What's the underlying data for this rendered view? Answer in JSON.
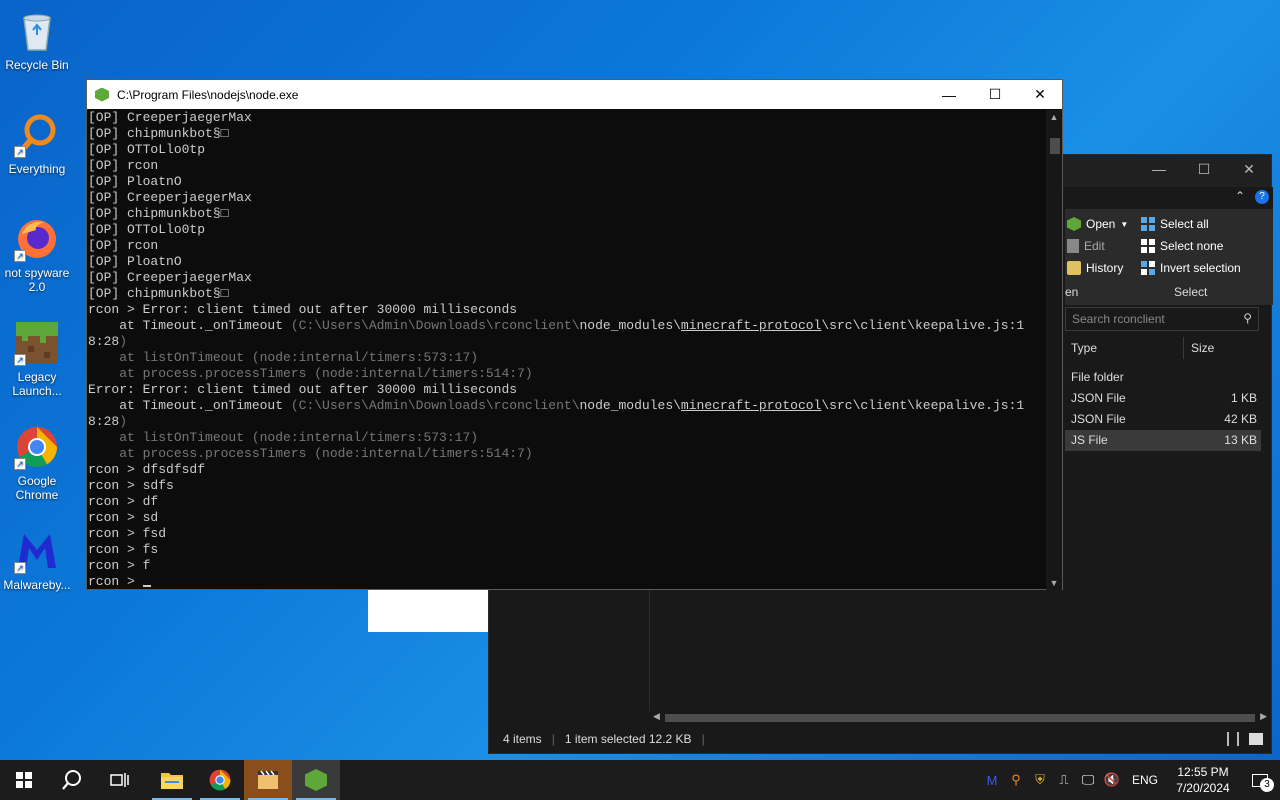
{
  "desktop": {
    "icons": [
      {
        "label": "Recycle Bin"
      },
      {
        "label": "Everything"
      },
      {
        "label": "not spyware 2.0"
      },
      {
        "label": "Legacy Launch..."
      },
      {
        "label": "Google Chrome"
      },
      {
        "label": "Malwareby..."
      }
    ]
  },
  "console": {
    "title": "C:\\Program Files\\nodejs\\node.exe",
    "lines": [
      {
        "segments": [
          {
            "t": "[OP] CreeperjaegerMax"
          }
        ]
      },
      {
        "segments": [
          {
            "t": "[OP] chipmunkbot§□"
          }
        ]
      },
      {
        "segments": [
          {
            "t": "[OP] OTToLlo0tp"
          }
        ]
      },
      {
        "segments": [
          {
            "t": "[OP] rcon"
          }
        ]
      },
      {
        "segments": [
          {
            "t": "[OP] PloatnO"
          }
        ]
      },
      {
        "segments": [
          {
            "t": "[OP] CreeperjaegerMax"
          }
        ]
      },
      {
        "segments": [
          {
            "t": "[OP] chipmunkbot§□"
          }
        ]
      },
      {
        "segments": [
          {
            "t": "[OP] OTToLlo0tp"
          }
        ]
      },
      {
        "segments": [
          {
            "t": "[OP] rcon"
          }
        ]
      },
      {
        "segments": [
          {
            "t": "[OP] PloatnO"
          }
        ]
      },
      {
        "segments": [
          {
            "t": "[OP] CreeperjaegerMax"
          }
        ]
      },
      {
        "segments": [
          {
            "t": "[OP] chipmunkbot§□"
          }
        ]
      },
      {
        "segments": [
          {
            "t": "rcon > Error: client timed out after 30000 milliseconds"
          }
        ]
      },
      {
        "segments": [
          {
            "t": "    at Timeout._onTimeout "
          },
          {
            "t": "(C:\\Users\\Admin\\Downloads\\rconclient\\",
            "c": "dim"
          },
          {
            "t": "node_modules\\"
          },
          {
            "t": "minecraft-protocol",
            "c": "ul"
          },
          {
            "t": "\\src\\client\\keepalive.js:1"
          }
        ]
      },
      {
        "segments": [
          {
            "t": "8:28",
            "c": ""
          },
          {
            "t": ")",
            "c": "dim"
          }
        ]
      },
      {
        "segments": [
          {
            "t": "    at listOnTimeout (node:internal/timers:573:17)",
            "c": "dim"
          }
        ]
      },
      {
        "segments": [
          {
            "t": "    at process.processTimers (node:internal/timers:514:7)",
            "c": "dim"
          }
        ]
      },
      {
        "segments": [
          {
            "t": "Error: Error: client timed out after 30000 milliseconds"
          }
        ]
      },
      {
        "segments": [
          {
            "t": "    at Timeout._onTimeout "
          },
          {
            "t": "(C:\\Users\\Admin\\Downloads\\rconclient\\",
            "c": "dim"
          },
          {
            "t": "node_modules\\"
          },
          {
            "t": "minecraft-protocol",
            "c": "ul"
          },
          {
            "t": "\\src\\client\\keepalive.js:1"
          }
        ]
      },
      {
        "segments": [
          {
            "t": "8:28",
            "c": ""
          },
          {
            "t": ")",
            "c": "dim"
          }
        ]
      },
      {
        "segments": [
          {
            "t": "    at listOnTimeout (node:internal/timers:573:17)",
            "c": "dim"
          }
        ]
      },
      {
        "segments": [
          {
            "t": "    at process.processTimers (node:internal/timers:514:7)",
            "c": "dim"
          }
        ]
      },
      {
        "segments": [
          {
            "t": "rcon > dfsdfsdf"
          }
        ]
      },
      {
        "segments": [
          {
            "t": "rcon > sdfs"
          }
        ]
      },
      {
        "segments": [
          {
            "t": "rcon > df"
          }
        ]
      },
      {
        "segments": [
          {
            "t": "rcon > sd"
          }
        ]
      },
      {
        "segments": [
          {
            "t": "rcon > fsd"
          }
        ]
      },
      {
        "segments": [
          {
            "t": "rcon > fs"
          }
        ]
      },
      {
        "segments": [
          {
            "t": "rcon > f"
          }
        ]
      },
      {
        "segments": [
          {
            "t": "rcon > "
          }
        ],
        "cursor": true
      }
    ]
  },
  "explorer": {
    "ribbon": {
      "open": "Open",
      "edit": "Edit",
      "history": "History",
      "open_group": "en",
      "select_all": "Select all",
      "select_none": "Select none",
      "invert_selection": "Invert selection",
      "select_group": "Select"
    },
    "search_placeholder": "Search rconclient",
    "columns": {
      "type": "Type",
      "size": "Size"
    },
    "files": [
      {
        "type": "File folder",
        "size": ""
      },
      {
        "type": "JSON File",
        "size": "1 KB"
      },
      {
        "type": "JSON File",
        "size": "42 KB"
      },
      {
        "type": "JS File",
        "size": "13 KB",
        "selected": true
      }
    ],
    "status": {
      "items": "4 items",
      "selected": "1 item selected  12.2 KB"
    }
  },
  "taskbar": {
    "lang": "ENG",
    "time": "12:55 PM",
    "date": "7/20/2024",
    "notifications": "3"
  }
}
